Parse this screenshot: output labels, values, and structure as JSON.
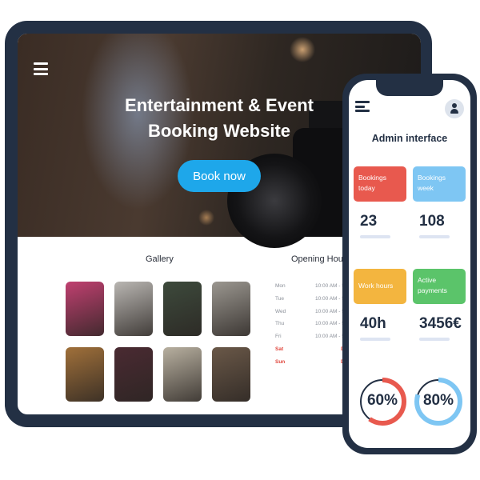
{
  "colors": {
    "device_frame": "#233044",
    "accent_blue": "#1ea7ea",
    "card_red": "#e8594e",
    "card_blue": "#7ec6f3",
    "card_orange": "#f3b53f",
    "card_green": "#5bc46a",
    "weekend_red": "#e0463c"
  },
  "website": {
    "menu_icon": "hamburger-menu-icon",
    "title_line1": "Entertainment & Event",
    "title_line2": "Booking Website",
    "book_button": "Book now",
    "gallery_title": "Gallery",
    "gallery_images": [
      {
        "color": "#c04070"
      },
      {
        "color": "#b9b6b2"
      },
      {
        "color": "#3d4a3c"
      },
      {
        "color": "#9b9790"
      },
      {
        "color": "#a0703a"
      },
      {
        "color": "#4a2a32"
      },
      {
        "color": "#b8b0a0"
      },
      {
        "color": "#6a5848"
      }
    ],
    "opening_hours_title": "Opening Hours",
    "hours": [
      {
        "day": "Mon",
        "time": "10:00 AM - 5:",
        "weekend": false
      },
      {
        "day": "Tue",
        "time": "10:00 AM - 5:",
        "weekend": false
      },
      {
        "day": "Wed",
        "time": "10:00 AM - 5:",
        "weekend": false
      },
      {
        "day": "Thu",
        "time": "10:00 AM - 5:",
        "weekend": false
      },
      {
        "day": "Fri",
        "time": "10:00 AM - 5:",
        "weekend": false
      },
      {
        "day": "Sat",
        "time": "D",
        "weekend": true
      },
      {
        "day": "Sun",
        "time": "D",
        "weekend": true
      }
    ]
  },
  "admin": {
    "menu_icon": "hamburger-menu-icon",
    "avatar_icon": "user-avatar-icon",
    "title": "Admin interface",
    "cards": [
      {
        "label": "Bookings today",
        "value": "23",
        "color": "#e8594e"
      },
      {
        "label": "Bookings week",
        "value": "108",
        "color": "#7ec6f3"
      },
      {
        "label": "Work hours",
        "value": "40h",
        "color": "#f3b53f"
      },
      {
        "label": "Active payments",
        "value": "3456€",
        "color": "#5bc46a"
      }
    ],
    "rings": [
      {
        "label": "60%",
        "value": 60,
        "color": "#e8594e"
      },
      {
        "label": "80%",
        "value": 80,
        "color": "#7ec6f3"
      }
    ]
  }
}
